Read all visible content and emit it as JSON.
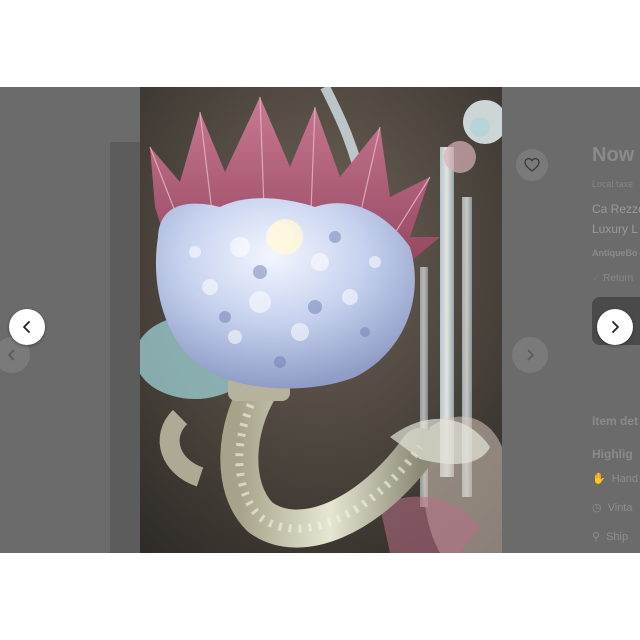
{
  "listing": {
    "title": "Now",
    "subtitle": "Local taxe",
    "line1": "Ca Rezzo",
    "line2": "Luxury L",
    "seller": "AntiqueBo",
    "returns": "Return",
    "item_details": "Item det",
    "highlights": "Highlig",
    "features": [
      "Hand",
      "Vinta",
      "Ship"
    ]
  },
  "gallery": {
    "photo_alt": "Venetian glass chandelier arm with opalescent cup and pink leaf rim",
    "icons": {
      "prev": "chevron-left-icon",
      "next": "chevron-right-icon",
      "favorite": "heart-icon"
    }
  },
  "colors": {
    "overlay": "#6b6b6b",
    "leaf_pink": "#b35c78",
    "opal_glass": "#c8d4ec",
    "nav_button": "#ffffff"
  }
}
